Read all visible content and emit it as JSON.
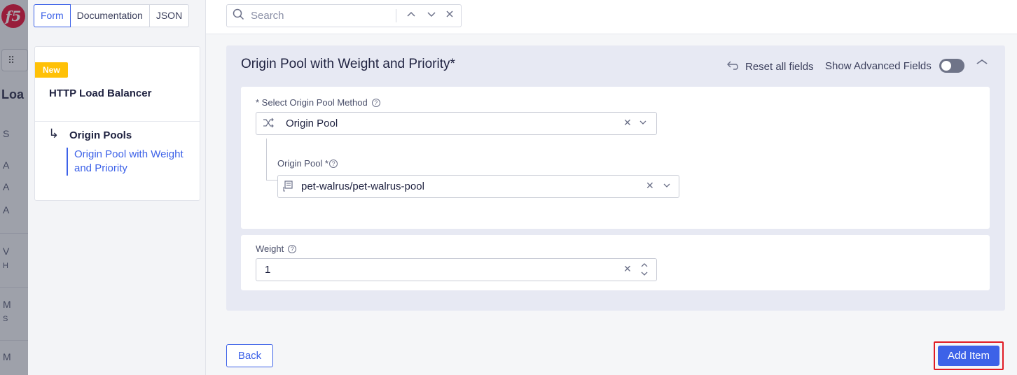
{
  "background_app": {
    "logo_text": "f5",
    "title_fragment": "Loa",
    "sidebar_letters": [
      "S",
      "A",
      "A",
      "A",
      "V",
      "H",
      "M",
      "S",
      "M"
    ]
  },
  "view_tabs": [
    "Form",
    "Documentation",
    "JSON"
  ],
  "active_view_tab": "Form",
  "navigator": {
    "badge": "New",
    "title": "HTTP Load Balancer",
    "section": "Origin Pools",
    "current_item": "Origin Pool with Weight and Priority"
  },
  "search": {
    "placeholder": "Search",
    "value": ""
  },
  "section": {
    "title": "Origin Pool with Weight and Priority",
    "required_mark": "*",
    "reset_label": "Reset all fields",
    "advanced_label": "Show Advanced Fields",
    "advanced_enabled": false
  },
  "method_field": {
    "label": "* Select Origin Pool Method",
    "value": "Origin Pool"
  },
  "origin_pool_field": {
    "label": "Origin Pool *",
    "value": "pet-walrus/pet-walrus-pool"
  },
  "weight_field": {
    "label": "Weight",
    "value": "1"
  },
  "footer": {
    "back_label": "Back",
    "add_label": "Add Item"
  },
  "colors": {
    "accent": "#3d62e8",
    "highlight_border": "#e01b24",
    "badge": "#ffc107"
  }
}
